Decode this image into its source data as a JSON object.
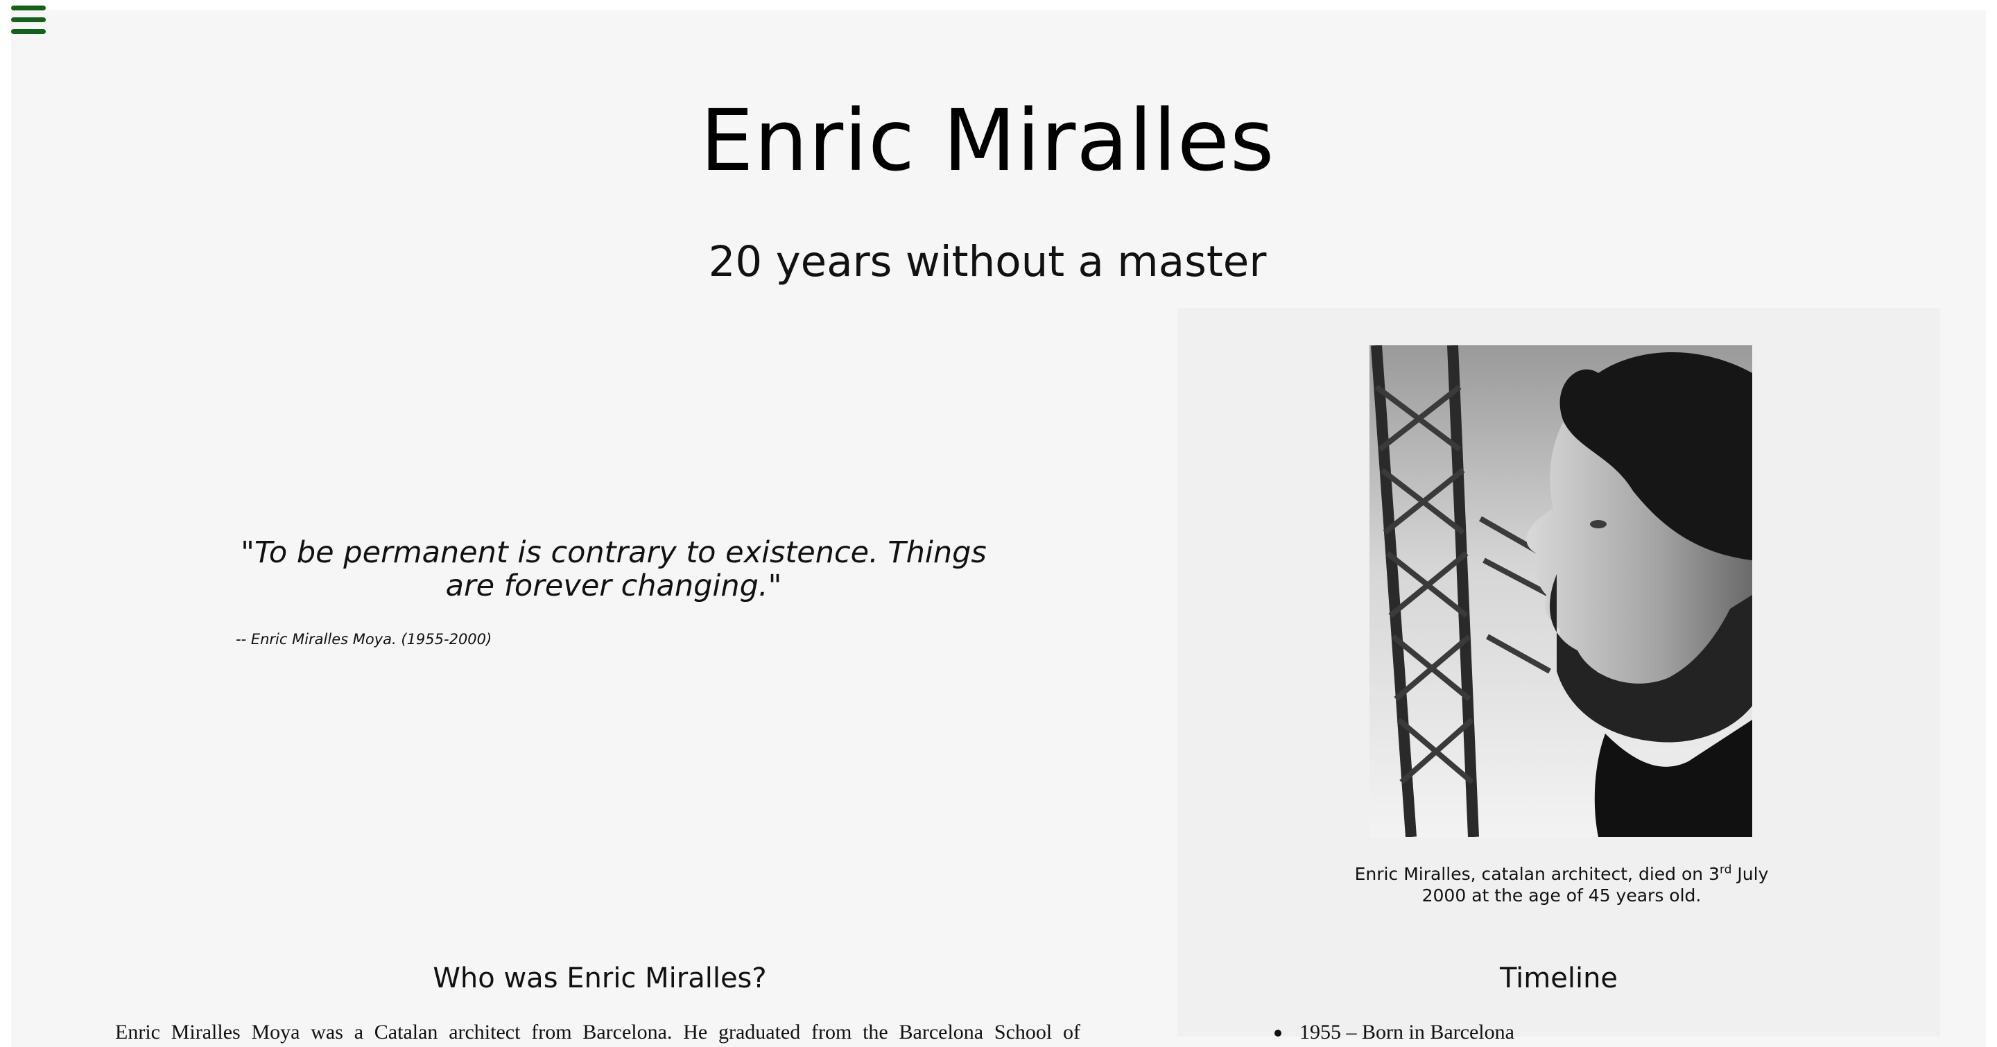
{
  "nav": {
    "menu_icon": "hamburger-menu-icon",
    "menu_color": "#16601c"
  },
  "header": {
    "title": "Enric Miralles",
    "subtitle": "20 years without a master"
  },
  "quote": {
    "text": "\"To be permanent is contrary to existence. Things are forever changing.\"",
    "author": "-- Enric Miralles Moya. (1955-2000)"
  },
  "portrait": {
    "caption_before": "Enric Miralles, catalan architect, died on 3",
    "caption_sup": "rd",
    "caption_after": " July 2000 at the age of 45 years old."
  },
  "about": {
    "heading": "Who was Enric Miralles?",
    "text": "Enric Miralles Moya was a Catalan architect from Barcelona. He graduated from the Barcelona School of"
  },
  "timeline": {
    "heading": "Timeline",
    "items": [
      "1955 – Born in Barcelona"
    ]
  }
}
